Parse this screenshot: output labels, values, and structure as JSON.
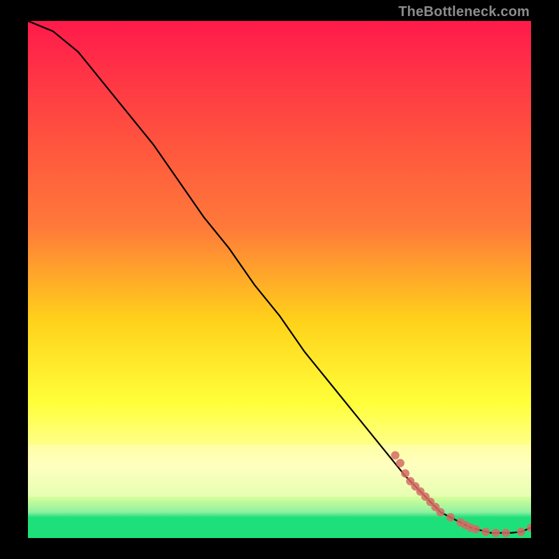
{
  "watermark": "TheBottleneck.com",
  "chart_data": {
    "type": "line",
    "title": "",
    "xlabel": "",
    "ylabel": "",
    "xlim": [
      0,
      100
    ],
    "ylim": [
      0,
      100
    ],
    "background_gradient": {
      "top_color": "#ff1a4b",
      "upper_mid_color": "#ff7a3a",
      "mid_color": "#ffd21a",
      "lower_mid_color": "#ffff3a",
      "band_color": "#ffffb0",
      "bottom_color": "#1ee07a"
    },
    "series": [
      {
        "name": "bottleneck-curve",
        "type": "line",
        "color": "#000000",
        "x": [
          0,
          5,
          10,
          15,
          20,
          25,
          30,
          35,
          40,
          45,
          50,
          55,
          60,
          65,
          70,
          75,
          78,
          80,
          82,
          84,
          86,
          88,
          90,
          92,
          94,
          96,
          98,
          100
        ],
        "y": [
          100,
          98,
          94,
          88,
          82,
          76,
          69,
          62,
          56,
          49,
          43,
          36,
          30,
          24,
          18,
          12,
          9,
          7,
          5,
          4,
          3,
          2,
          1.5,
          1,
          1,
          1,
          1.2,
          2
        ]
      },
      {
        "name": "highlight-points",
        "type": "scatter",
        "color": "#d66a63",
        "x": [
          73,
          74,
          75,
          76,
          77,
          78,
          79,
          80,
          81,
          82,
          84,
          86,
          87,
          88,
          89,
          91,
          93,
          95,
          98,
          100
        ],
        "y": [
          16,
          14.5,
          12.5,
          11,
          10,
          9,
          8,
          7,
          6,
          5,
          4,
          3,
          2.5,
          2,
          1.7,
          1.2,
          1,
          1,
          1.2,
          2
        ]
      }
    ]
  }
}
